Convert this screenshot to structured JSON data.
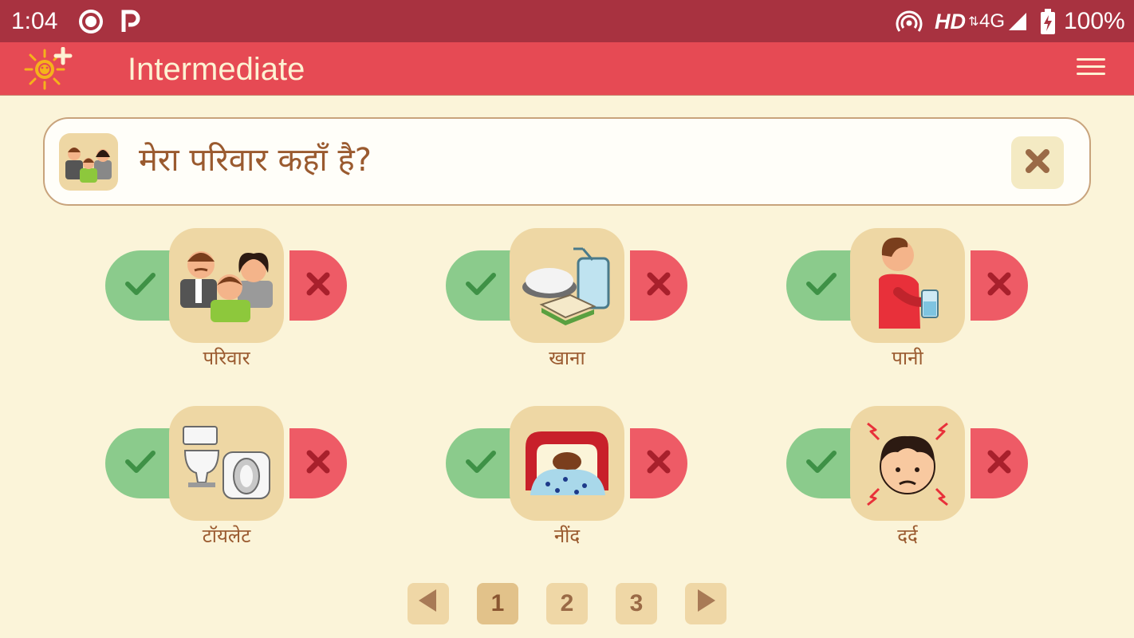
{
  "status_bar": {
    "time": "1:04",
    "network_label": "HD",
    "network_type": "4G",
    "battery": "100%",
    "left_icons": [
      "record-icon",
      "p-app-icon"
    ],
    "right_icons": [
      "hotspot-icon",
      "signal-icon",
      "battery-charging-icon"
    ]
  },
  "app_bar": {
    "title": "Intermediate",
    "logo": "sun-plus-logo",
    "menu_icon": "hamburger-menu-icon"
  },
  "sentence_bar": {
    "text": "मेरा परिवार कहाँ है?",
    "thumb_icon": "family-icon",
    "clear_icon": "close-icon"
  },
  "cards": [
    {
      "label": "परिवार",
      "icon": "family-icon"
    },
    {
      "label": "खाना",
      "icon": "food-icon"
    },
    {
      "label": "पानी",
      "icon": "drinking-water-icon"
    },
    {
      "label": "टॉयलेट",
      "icon": "toilet-icon"
    },
    {
      "label": "नींद",
      "icon": "sleep-icon"
    },
    {
      "label": "दर्द",
      "icon": "pain-icon"
    }
  ],
  "pagination": {
    "prev_icon": "triangle-left-icon",
    "pages": [
      "1",
      "2",
      "3"
    ],
    "current": "1",
    "next_icon": "triangle-right-icon"
  },
  "colors": {
    "status_bar": "#a83240",
    "app_bar": "#e64a54",
    "background": "#fbf4d9",
    "yes": "#8bcb8c",
    "no": "#ee5b66",
    "tile": "#eed7a4",
    "text": "#9a5a2f"
  }
}
